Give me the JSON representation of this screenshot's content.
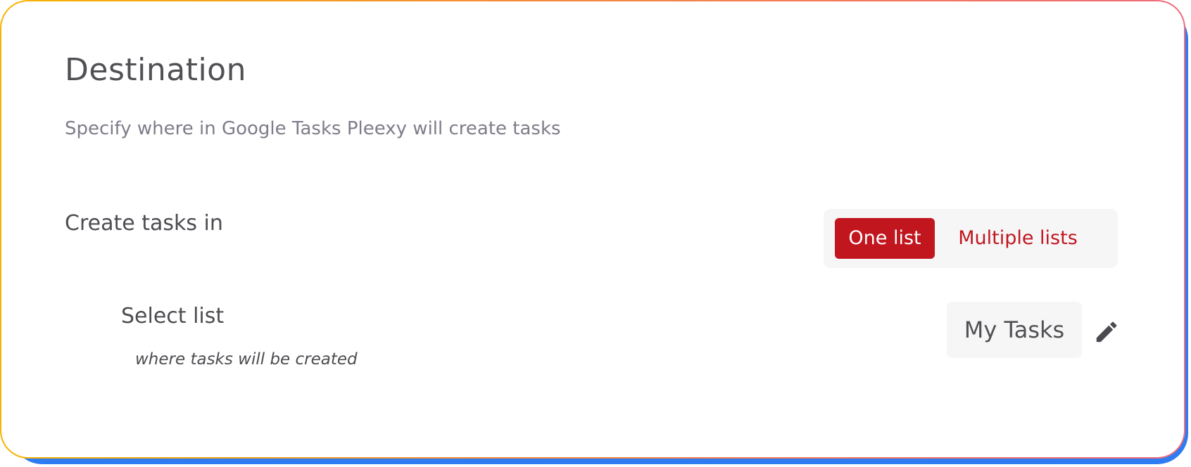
{
  "card": {
    "title": "Destination",
    "subtitle": "Specify where in Google Tasks Pleexy will create tasks"
  },
  "create_tasks": {
    "label": "Create tasks in",
    "options": [
      {
        "label": "One list",
        "selected": true
      },
      {
        "label": "Multiple lists",
        "selected": false
      }
    ]
  },
  "select_list": {
    "label": "Select list",
    "hint": "where tasks will be created",
    "value": "My Tasks",
    "edit_icon": "pencil-icon"
  },
  "colors": {
    "accent": "#c2161f",
    "frame_shadow": "#2f7bf2",
    "frame_gradient_start": "#f5b400",
    "frame_gradient_end": "#f06a7a"
  }
}
